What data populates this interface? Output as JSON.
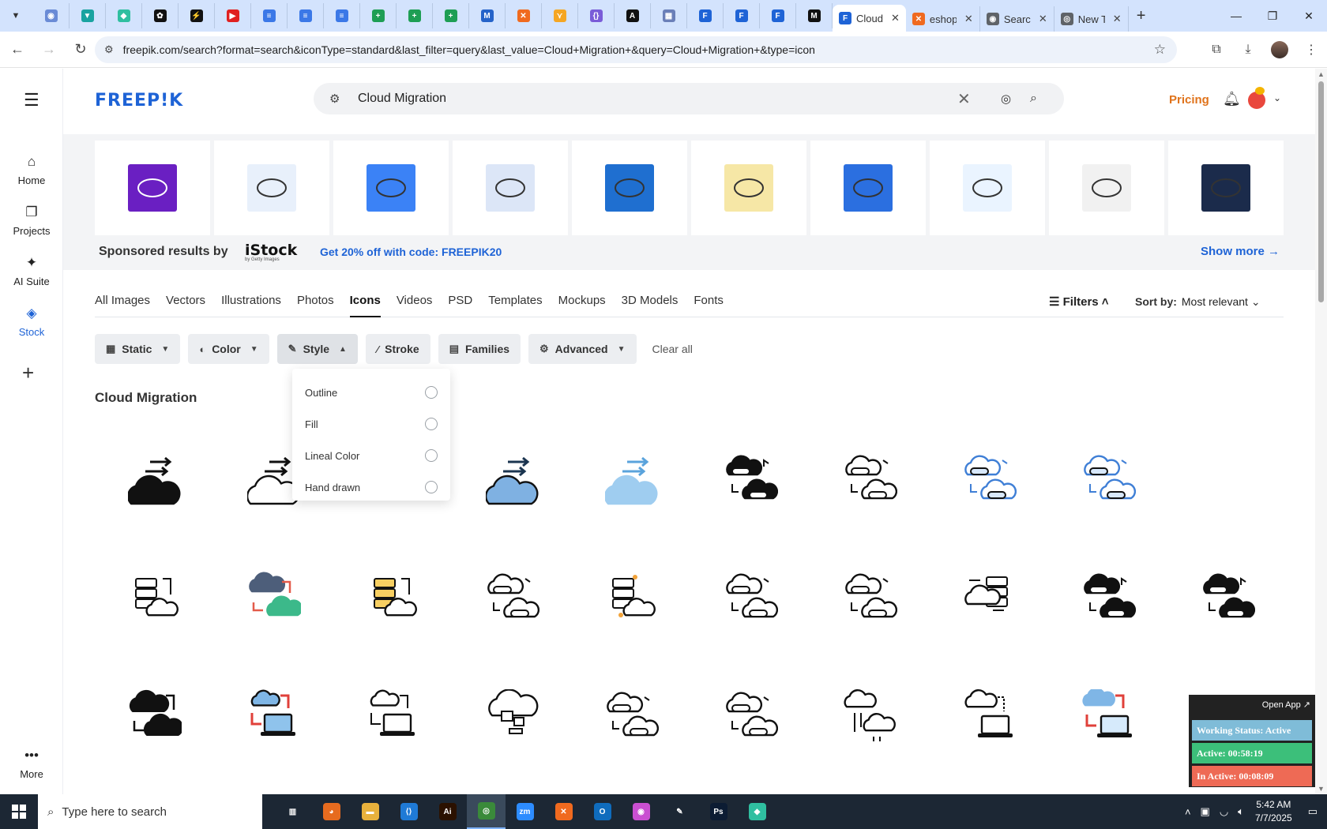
{
  "browser": {
    "pinned_tabs": [
      {
        "icon": "globe-icon",
        "color": "#6a8bd6"
      },
      {
        "icon": "vpn-icon",
        "color": "#19a3a0"
      },
      {
        "icon": "tag-icon",
        "color": "#2fbfa0"
      },
      {
        "icon": "openai-icon",
        "color": "#111111"
      },
      {
        "icon": "bolt-icon",
        "color": "#111111"
      },
      {
        "icon": "youtube-icon",
        "color": "#e02020"
      },
      {
        "icon": "docs-icon",
        "color": "#3b78e7"
      },
      {
        "icon": "docs-icon",
        "color": "#3b78e7"
      },
      {
        "icon": "docs-icon",
        "color": "#3b78e7"
      },
      {
        "icon": "sheets-icon",
        "color": "#1e9e54"
      },
      {
        "icon": "sheets-icon",
        "color": "#1e9e54"
      },
      {
        "icon": "sheets-icon",
        "color": "#1e9e54"
      },
      {
        "icon": "ms-icon",
        "color": "#2563c9"
      },
      {
        "icon": "xampp-icon",
        "color": "#f06a1f"
      },
      {
        "icon": "bird-icon",
        "color": "#f5a623"
      },
      {
        "icon": "code-icon",
        "color": "#7a5cd8"
      },
      {
        "icon": "a-icon",
        "color": "#111111"
      },
      {
        "icon": "grid-icon",
        "color": "#6a7fb8"
      },
      {
        "icon": "freepik-icon",
        "color": "#1e63d6"
      },
      {
        "icon": "freepik-icon",
        "color": "#1e63d6"
      },
      {
        "icon": "freepik-icon",
        "color": "#1e63d6"
      },
      {
        "icon": "m-icon",
        "color": "#111111"
      }
    ],
    "tabs": [
      {
        "label": "Cloud",
        "icon": "freepik-icon",
        "color": "#1e63d6",
        "active": true
      },
      {
        "label": "eshop",
        "icon": "xampp-icon",
        "color": "#f06a1f",
        "active": false
      },
      {
        "label": "Searc",
        "icon": "globe-icon",
        "color": "#5f6368",
        "active": false
      },
      {
        "label": "New T",
        "icon": "chrome-icon",
        "color": "#5f6368",
        "active": false
      }
    ],
    "url": "freepik.com/search?format=search&iconType=standard&last_filter=query&last_value=Cloud+Migration+&query=Cloud+Migration+&type=icon"
  },
  "sidenav": {
    "items": [
      {
        "label": "Home",
        "icon": "home-icon"
      },
      {
        "label": "Projects",
        "icon": "projects-icon"
      },
      {
        "label": "AI Suite",
        "icon": "sparkle-icon"
      },
      {
        "label": "Stock",
        "icon": "stock-icon"
      }
    ],
    "more": "More"
  },
  "header": {
    "logo": "FREEP!K",
    "search_value": "Cloud Migration",
    "pricing": "Pricing"
  },
  "sponsored": {
    "label": "Sponsored results by",
    "brand": "iStock",
    "brand_sub": "by Getty Images",
    "promo": "Get 20% off with code: FREEPIK20",
    "show_more": "Show more →"
  },
  "type_tabs": [
    "All Images",
    "Vectors",
    "Illustrations",
    "Photos",
    "Icons",
    "Videos",
    "PSD",
    "Templates",
    "Mockups",
    "3D Models",
    "Fonts"
  ],
  "active_type_tab": "Icons",
  "filters_label": "Filters",
  "sort": {
    "label": "Sort by:",
    "value": "Most relevant"
  },
  "filter_buttons": [
    "Static",
    "Color",
    "Style",
    "Stroke",
    "Families",
    "Advanced"
  ],
  "clear_all": "Clear all",
  "style_options": [
    "Outline",
    "Fill",
    "Lineal Color",
    "Hand drawn"
  ],
  "section_title": "Cloud Migration",
  "working_status": {
    "open_app": "Open App ↗",
    "status": "Working Status: Active",
    "active": "Active: 00:58:19",
    "inactive": "In Active: 00:08:09"
  },
  "taskbar": {
    "search_placeholder": "Type here to search",
    "time": "5:42 AM",
    "date": "7/7/2025"
  },
  "colors": {
    "accent": "#1e63d6",
    "pricing": "#e0731b",
    "tab_strip": "#d3e3fd"
  }
}
